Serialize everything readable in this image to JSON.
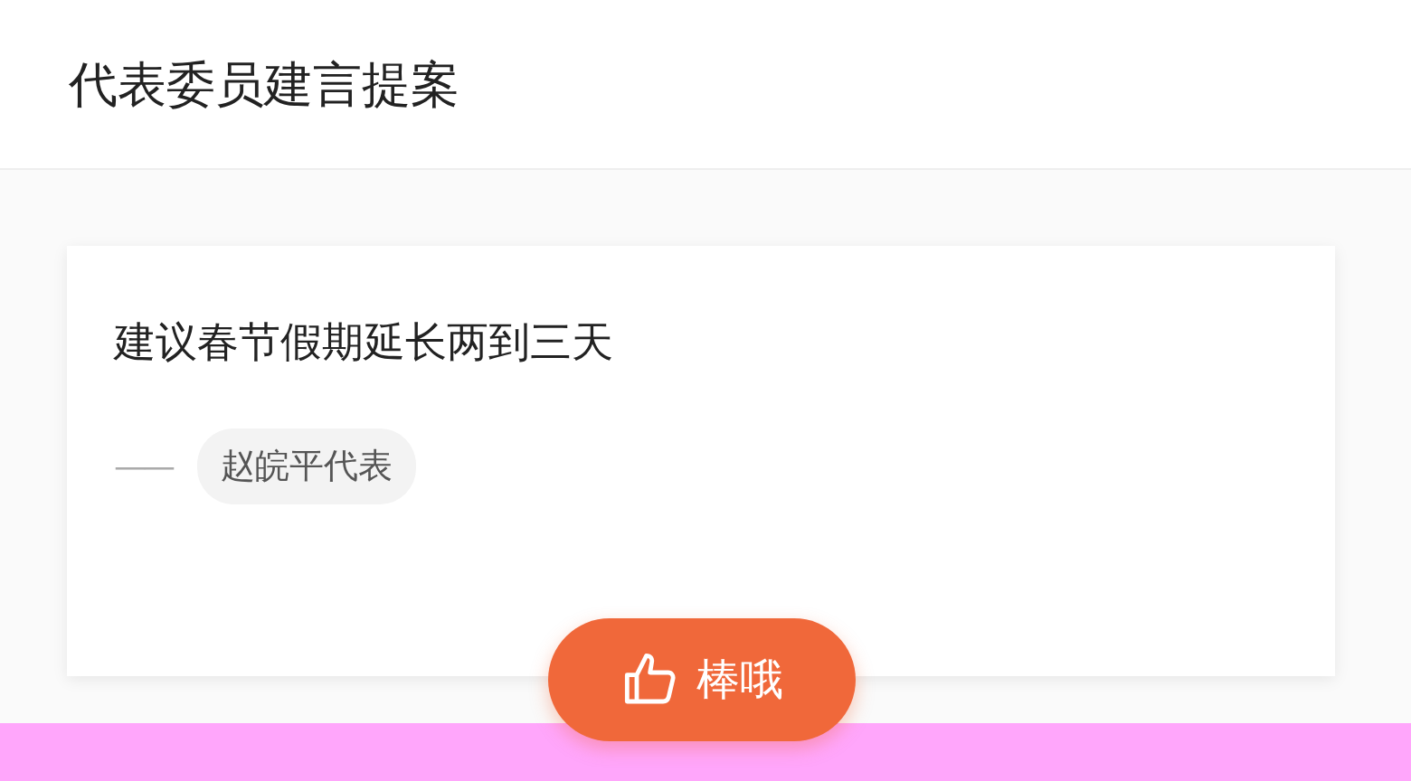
{
  "header": {
    "title": "代表委员建言提案"
  },
  "card": {
    "title": "建议春节假期延长两到三天",
    "dash": "——",
    "author": "赵皖平代表"
  },
  "like_button": {
    "label": "棒哦"
  }
}
